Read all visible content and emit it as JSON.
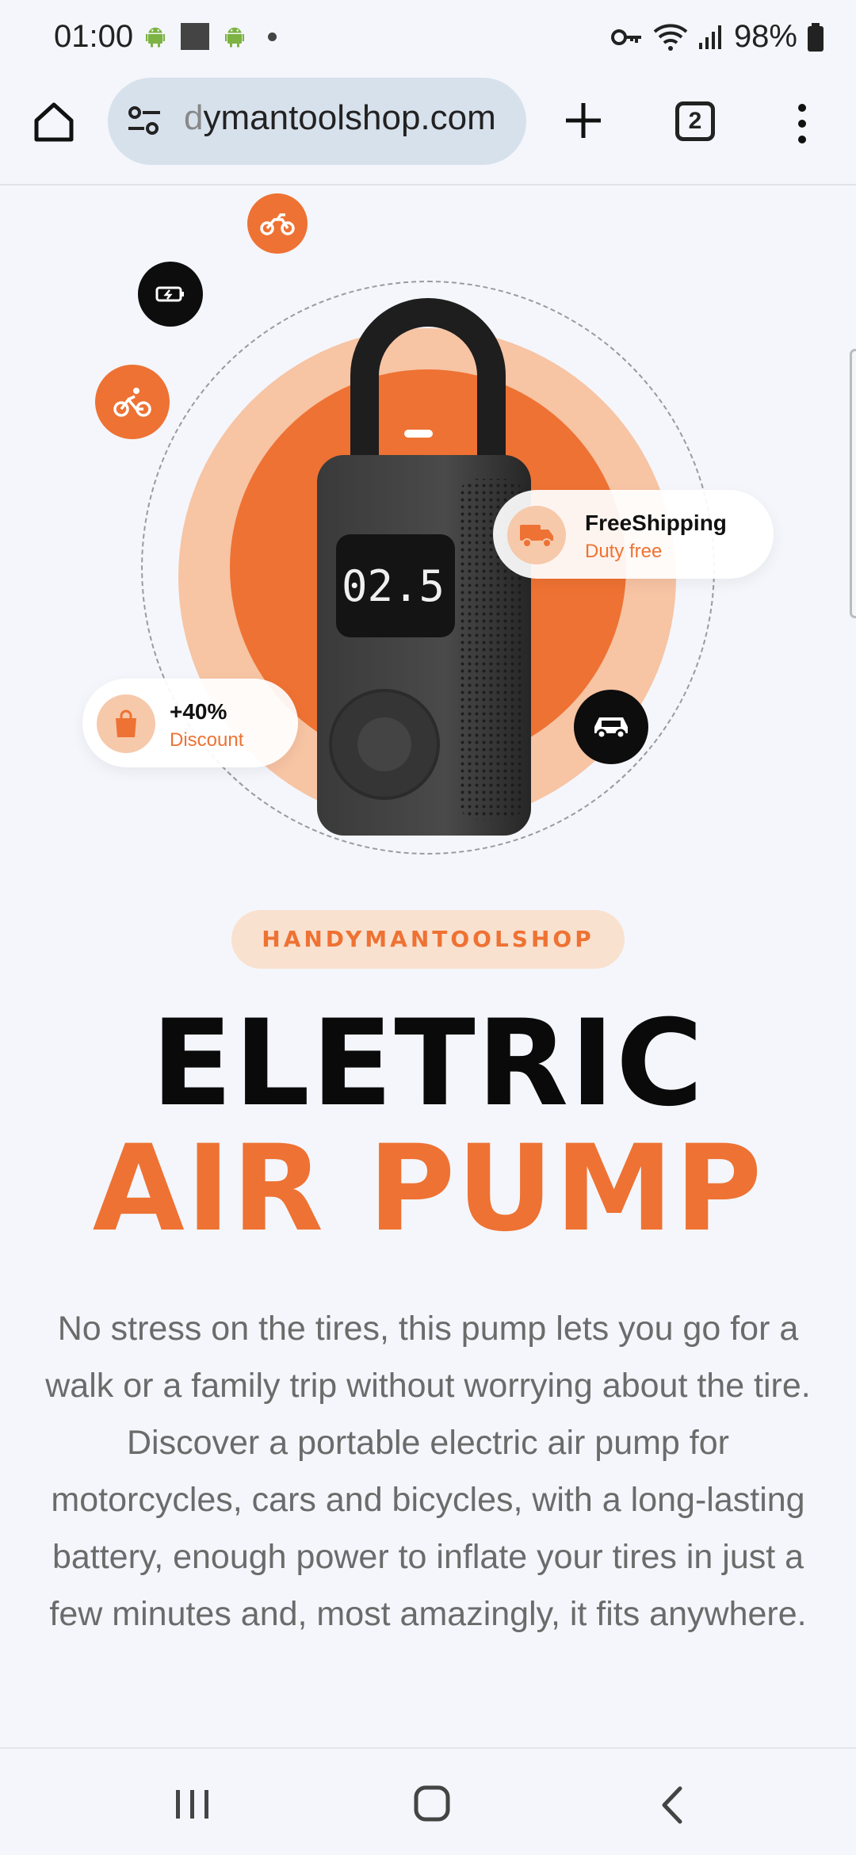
{
  "status_bar": {
    "time": "01:00",
    "battery": "98%"
  },
  "browser": {
    "url": "dymantoolshop.com",
    "tab_count": "2"
  },
  "hero": {
    "shipping_title": "FreeShipping",
    "shipping_sub": "Duty free",
    "discount_title": "+40%",
    "discount_sub": "Discount",
    "pump_display": "02.5",
    "icons": [
      "motorcycle-icon",
      "battery-icon",
      "bicycle-icon",
      "car-icon",
      "truck-icon",
      "shopping-bag-icon"
    ]
  },
  "content": {
    "brand": "HANDYMANTOOLSHOP",
    "title_line1": "ELETRIC",
    "title_line2": "AIR PUMP",
    "description": "No stress on the tires, this pump lets you go for a walk or a family trip without worrying about the tire. Discover a portable electric air pump for motorcycles, cars and bicycles, with a long-lasting battery, enough power to inflate your tires in just a few minutes and, most amazingly, it fits anywhere."
  },
  "colors": {
    "accent": "#ee7233",
    "accent_light": "#f7c4a4",
    "background": "#f4f6fb"
  }
}
